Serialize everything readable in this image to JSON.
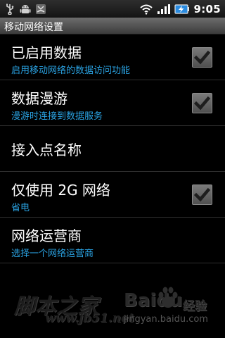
{
  "status_bar": {
    "time": "9:05",
    "left_icons": [
      "usb-icon",
      "android-debug-icon",
      "phone-missed-icon"
    ],
    "right_icons": [
      "wifi-icon",
      "signal-icon",
      "battery-charging-icon"
    ]
  },
  "title_bar": {
    "title": "移动网络设置"
  },
  "settings": [
    {
      "title": "已启用数据",
      "summary": "启用移动网络的数据访问功能",
      "checked": true
    },
    {
      "title": "数据漫游",
      "summary": "漫游时连接到数据服务",
      "checked": true
    },
    {
      "title": "接入点名称"
    },
    {
      "title": "仅使用 2G 网络",
      "summary": "省电",
      "checked": true
    },
    {
      "title": "网络运营商",
      "summary": "选择一个网络运营商"
    }
  ],
  "watermarks": {
    "left_main": "脚本之家",
    "left_sub": "www.jb51.net",
    "right_logo": "Baidu",
    "right_label": "经验",
    "right_url": "jingyan.baidu.com"
  },
  "colors": {
    "summary_text": "#2aa3e3",
    "checkbox_check": "#1e1e1e"
  }
}
